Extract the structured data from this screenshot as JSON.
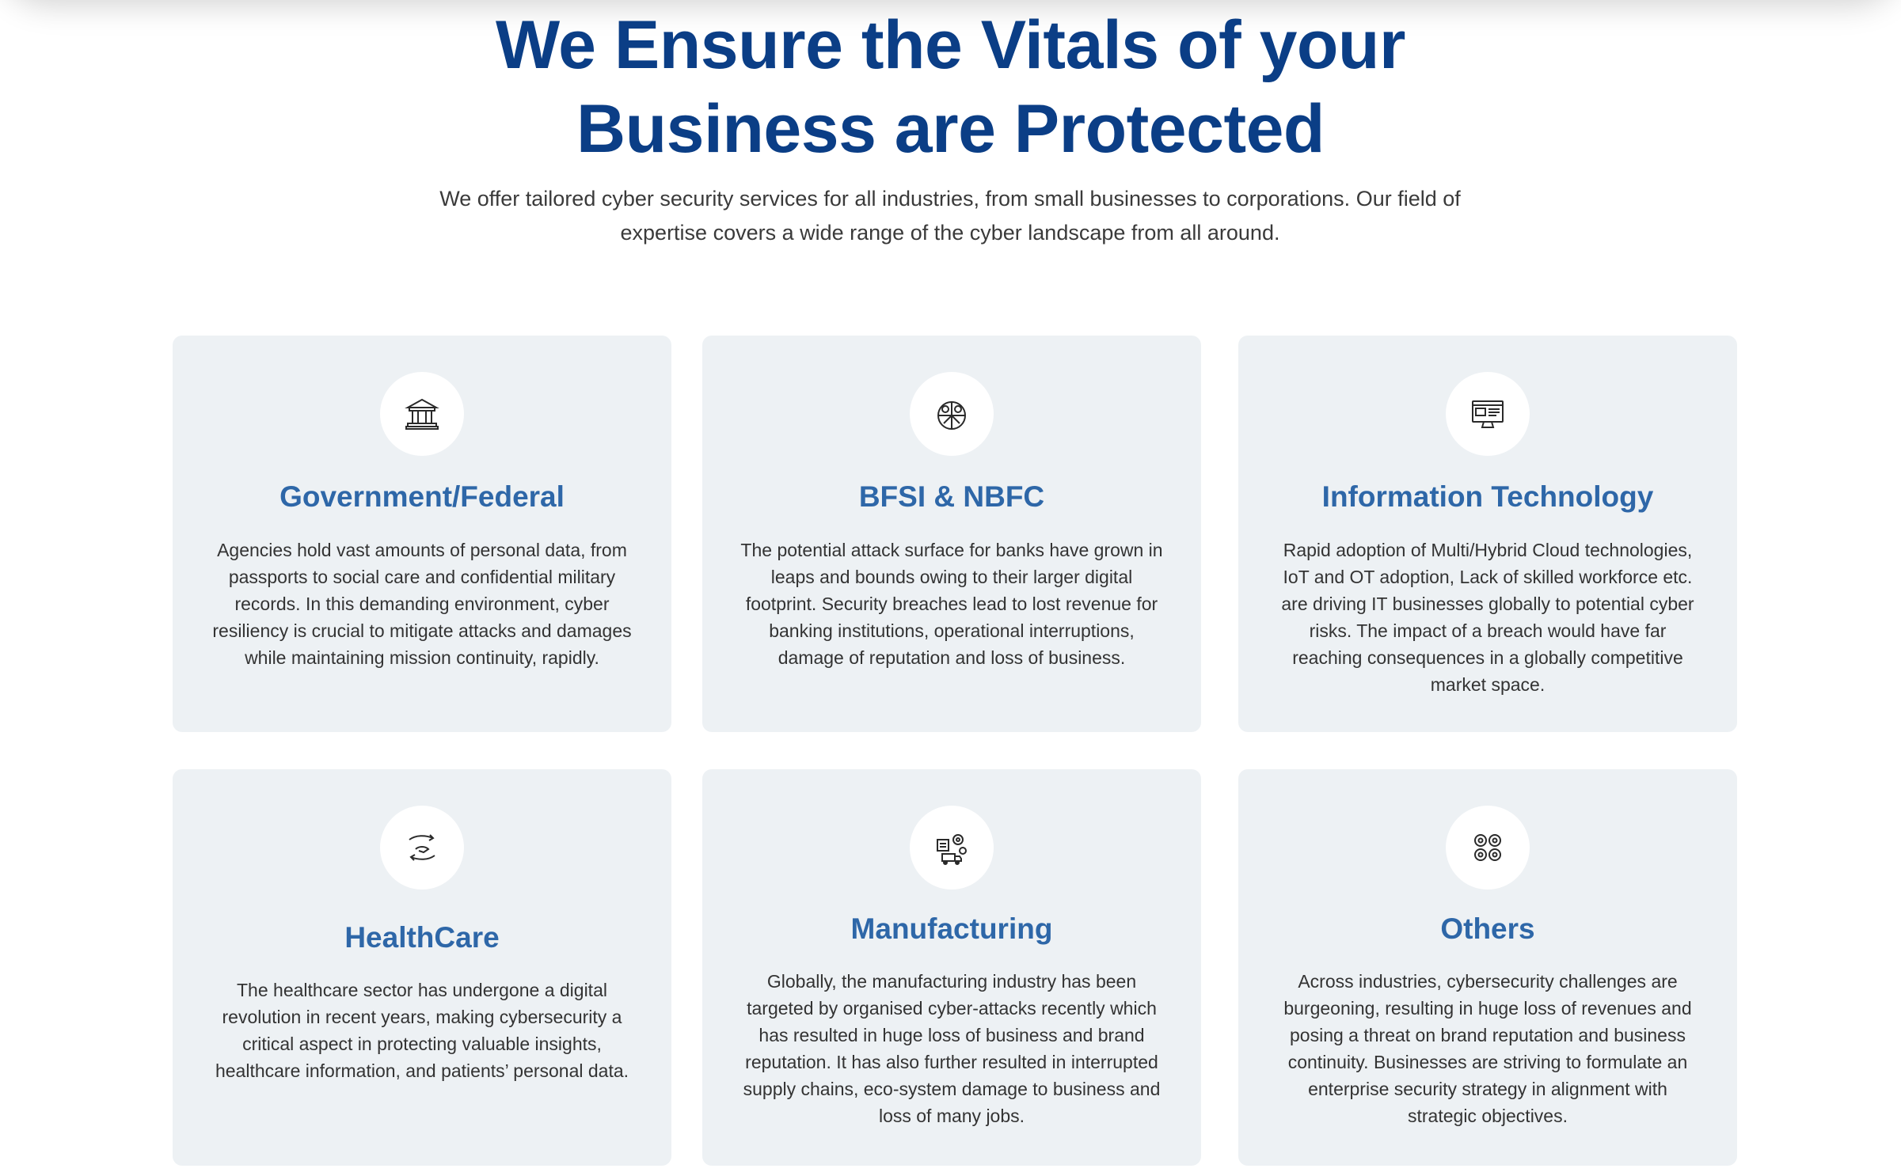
{
  "hero": {
    "title_line1": "We Ensure the Vitals of your",
    "title_line2": "Business are Protected",
    "subtitle": "We offer tailored cyber security services for all industries, from small businesses to corporations. Our field of expertise covers a wide range of the cyber landscape from all around."
  },
  "colors": {
    "title": "#0b3e86",
    "card_title": "#2e67a8",
    "card_background": "#edf1f4",
    "body_text": "#333333"
  },
  "industries": [
    {
      "icon": "government-building-icon",
      "title": "Government/Federal",
      "description": "Agencies hold vast amounts of personal data, from passports to social care and confidential military records. In this demanding environment, cyber resiliency is crucial to mitigate attacks and damages while maintaining mission continuity, rapidly."
    },
    {
      "icon": "finance-globe-icon",
      "title": "BFSI & NBFC",
      "description": "The potential attack surface for banks have grown in leaps and bounds owing to their larger digital footprint. Security breaches lead to lost revenue for banking institutions, operational interruptions, damage of reputation and loss of business."
    },
    {
      "icon": "computer-monitor-icon",
      "title": "Information Technology",
      "description": "Rapid adoption of Multi/Hybrid Cloud technologies, IoT and OT adoption, Lack of skilled workforce etc. are driving IT businesses globally to potential cyber risks. The impact of a breach would have far reaching consequences in a globally competitive market space."
    },
    {
      "icon": "healthcare-hand-icon",
      "title": "HealthCare",
      "description": "The healthcare sector has undergone a digital revolution in recent years, making cybersecurity a critical aspect in protecting valuable insights, healthcare information, and patients’ personal data."
    },
    {
      "icon": "manufacturing-gears-icon",
      "title": "Manufacturing",
      "description": "Globally, the manufacturing industry has been targeted by organised cyber-attacks recently which has resulted in huge loss of business and brand reputation. It has also further resulted in interrupted supply chains, eco-system damage to business and loss of many jobs."
    },
    {
      "icon": "network-nodes-icon",
      "title": "Others",
      "description": "Across industries, cybersecurity challenges are burgeoning, resulting in huge loss of revenues and posing a threat on brand reputation and business continuity. Businesses are striving to formulate an enterprise security strategy in alignment with strategic objectives."
    }
  ]
}
